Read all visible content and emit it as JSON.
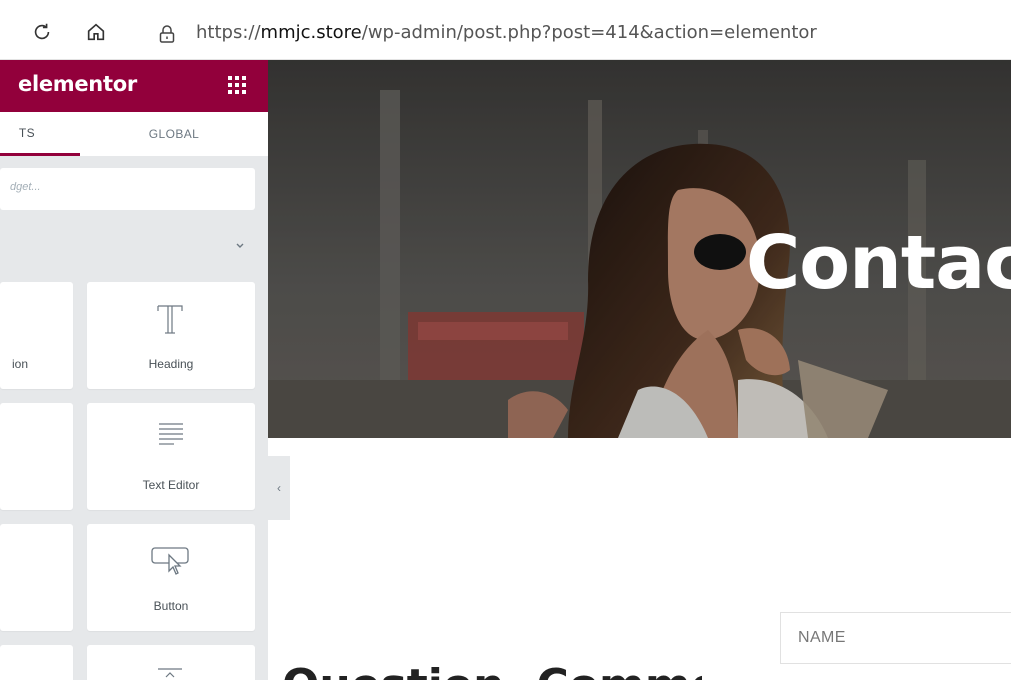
{
  "browser": {
    "url_prefix": "https://",
    "url_domain": "mmjc.store",
    "url_path": "/wp-admin/post.php?post=414&action=elementor"
  },
  "panel": {
    "logo": "elementor",
    "tabs": [
      {
        "label": "ELEMENTS",
        "visible": "TS"
      },
      {
        "label": "GLOBAL",
        "visible": "GLOBAL"
      }
    ],
    "search_placeholder": "Search Widget...",
    "search_visible": "dget...",
    "collapse_glyph": "‹",
    "widgets": [
      {
        "name": "Inner Section",
        "visible": "ion",
        "icon": "inner-section-icon"
      },
      {
        "name": "Heading",
        "visible": "Heading",
        "icon": "heading-icon"
      },
      {
        "name": "",
        "visible": "",
        "icon": ""
      },
      {
        "name": "Text Editor",
        "visible": "Text Editor",
        "icon": "text-editor-icon"
      },
      {
        "name": "",
        "visible": "",
        "icon": ""
      },
      {
        "name": "Button",
        "visible": "Button",
        "icon": "button-icon"
      },
      {
        "name": "",
        "visible": "",
        "icon": ""
      },
      {
        "name": "Divider",
        "visible": "",
        "icon": "divider-icon"
      }
    ]
  },
  "preview": {
    "hero_title": "Contac",
    "name_placeholder": "NAME",
    "partial_heading": "Question, Comment &"
  },
  "colors": {
    "brand": "#92003b",
    "panel_bg": "#e6e8ea"
  }
}
